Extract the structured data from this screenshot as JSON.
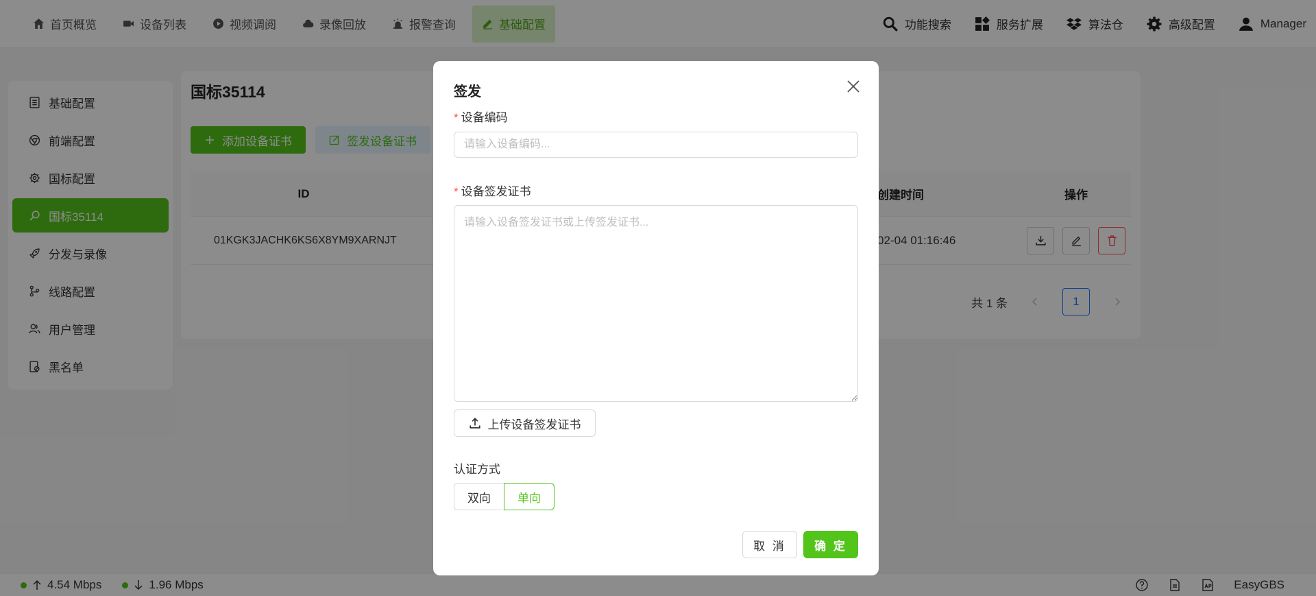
{
  "nav": {
    "items": [
      {
        "label": "首页概览",
        "icon": "home-icon"
      },
      {
        "label": "设备列表",
        "icon": "video-camera-icon"
      },
      {
        "label": "视频调阅",
        "icon": "play-circle-icon"
      },
      {
        "label": "录像回放",
        "icon": "cloud-icon"
      },
      {
        "label": "报警查询",
        "icon": "alarm-icon"
      },
      {
        "label": "基础配置",
        "icon": "edit-icon"
      }
    ],
    "right": [
      {
        "label": "功能搜索",
        "icon": "search-icon"
      },
      {
        "label": "服务扩展",
        "icon": "apps-icon"
      },
      {
        "label": "算法仓",
        "icon": "dropbox-icon"
      },
      {
        "label": "高级配置",
        "icon": "gear-icon"
      },
      {
        "label": "Manager",
        "icon": "user-icon"
      }
    ]
  },
  "sidebar": {
    "items": [
      {
        "label": "基础配置"
      },
      {
        "label": "前端配置"
      },
      {
        "label": "国标配置"
      },
      {
        "label": "国标35114"
      },
      {
        "label": "分发与录像"
      },
      {
        "label": "线路配置"
      },
      {
        "label": "用户管理"
      },
      {
        "label": "黑名单"
      }
    ]
  },
  "main": {
    "title": "国标35114",
    "add_button": "添加设备证书",
    "sign_button": "签发设备证书",
    "columns": {
      "id": "ID",
      "created": "创建时间",
      "ops": "操作"
    },
    "rows": [
      {
        "id": "01KGK3JACHK6KS6X8YM9XARNJT",
        "created": "02-04 01:16:46"
      }
    ],
    "pager": {
      "total": "共 1 条",
      "page": "1"
    }
  },
  "status": {
    "upload": "4.54 Mbps",
    "download": "1.96 Mbps",
    "brand": "EasyGBS"
  },
  "modal": {
    "title": "签发",
    "device_code_label": "设备编码",
    "device_code_placeholder": "请输入设备编码...",
    "cert_label": "设备签发证书",
    "cert_placeholder": "请输入设备签发证书或上传签发证书...",
    "upload_button": "上传设备签发证书",
    "auth_label": "认证方式",
    "auth_options": [
      "双向",
      "单向"
    ],
    "auth_selected": "单向",
    "cancel": "取 消",
    "ok": "确 定"
  },
  "colors": {
    "accent": "#52c41a",
    "danger": "#ff4d4f",
    "link": "#1677ff"
  }
}
